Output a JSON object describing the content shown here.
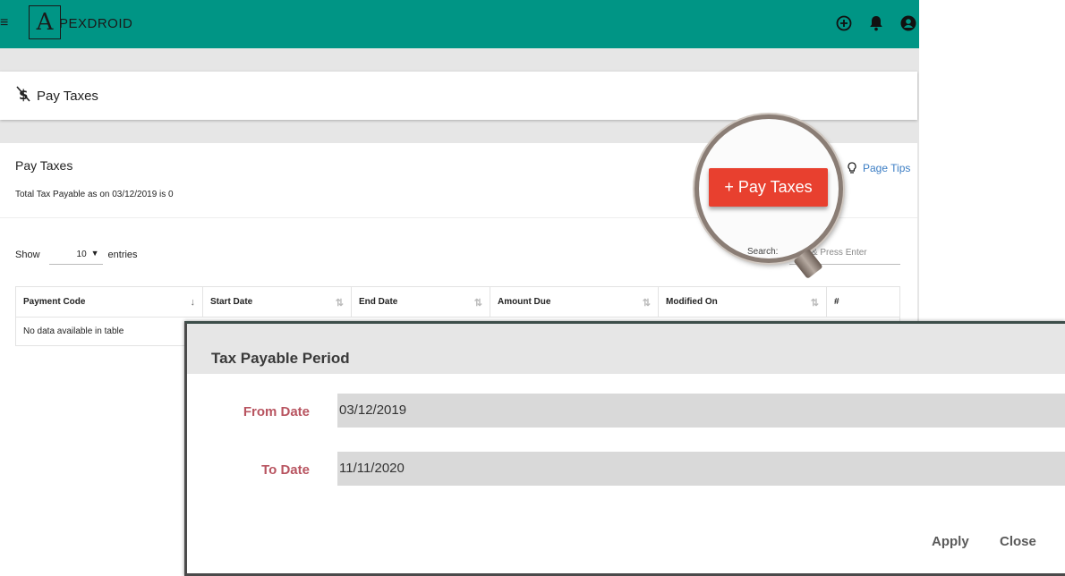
{
  "navbar": {
    "logo_letter": "A",
    "logo_text": "PEXDROID",
    "menu_icon": "hamburger-icon",
    "icons": [
      "add-circle-icon",
      "bell-icon",
      "account-icon"
    ],
    "bg_color": "#009585"
  },
  "page_header": {
    "icon": "no-dollar-icon",
    "title": "Pay Taxes"
  },
  "content": {
    "title": "Pay Taxes",
    "subtitle": "Total Tax Payable as on 03/12/2019 is 0",
    "page_tips": "Page Tips",
    "pay_button": "+ Pay Taxes",
    "show_label": "Show",
    "entries_value": "10",
    "entries_label": "entries",
    "search_label": "Search:",
    "search_placeholder": "Type & Press Enter",
    "table": {
      "columns": [
        "Payment Code",
        "Start Date",
        "End Date",
        "Amount Due",
        "Modified On",
        "#"
      ],
      "empty_text": "No data available in table"
    }
  },
  "dialog": {
    "title": "Tax Payable Period",
    "from_label": "From Date",
    "from_value": "03/12/2019",
    "to_label": "To Date",
    "to_value": "11/11/2020",
    "apply_label": "Apply",
    "close_label": "Close",
    "label_color": "#b85460"
  },
  "colors": {
    "accent": "#009585",
    "pay_button": "#e8402f",
    "link": "#3b7dc4"
  }
}
